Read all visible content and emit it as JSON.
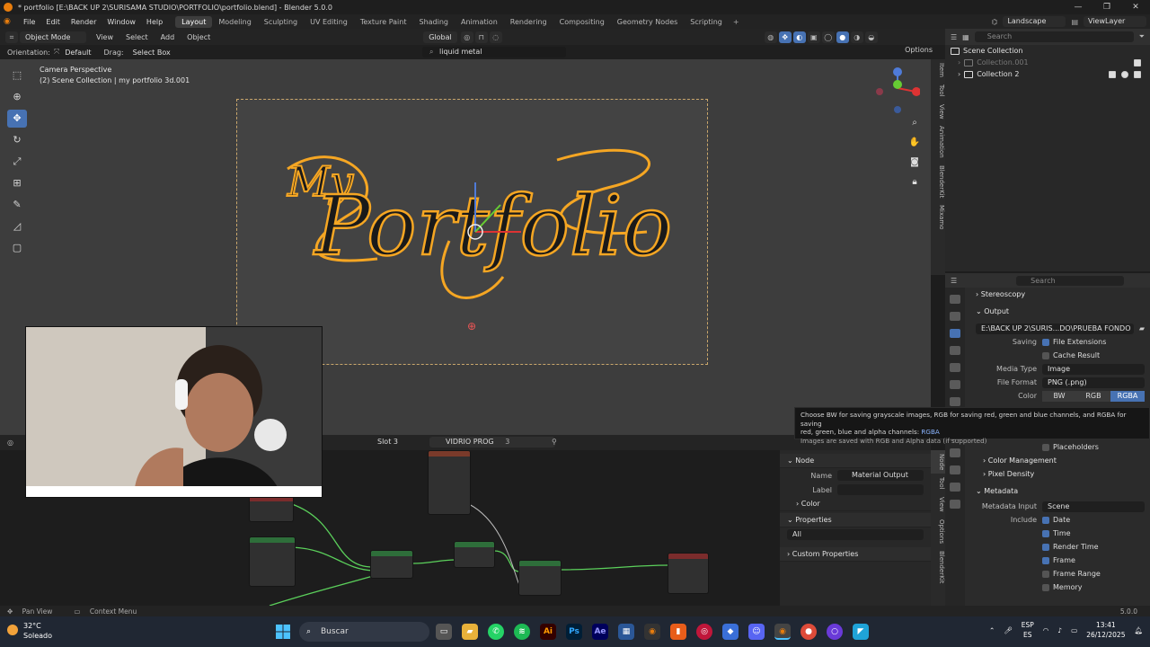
{
  "window": {
    "title": "* portfolio [E:\\BACK UP 2\\SURISAMA STUDIO\\PORTFOLIO\\portfolio.blend] - Blender 5.0.0",
    "controls": [
      "—",
      "❐",
      "✕"
    ]
  },
  "menubar": {
    "menus": [
      "File",
      "Edit",
      "Render",
      "Window",
      "Help"
    ],
    "workspaces": [
      "Layout",
      "Modeling",
      "Sculpting",
      "UV Editing",
      "Texture Paint",
      "Shading",
      "Animation",
      "Rendering",
      "Compositing",
      "Geometry Nodes",
      "Scripting"
    ],
    "active_workspace": "Layout",
    "scene": "Landscape",
    "view_layer": "ViewLayer"
  },
  "viewport_header": {
    "mode": "Object Mode",
    "menus": [
      "View",
      "Select",
      "Add",
      "Object"
    ],
    "transform": "Global"
  },
  "tool_settings": {
    "orientation_label": "Orientation:",
    "orientation_value": "Default",
    "drag_label": "Drag:",
    "drag_value": "Select Box",
    "search_value": "liquid metal",
    "options_label": "Options"
  },
  "viewport": {
    "camera_label": "Camera Perspective",
    "collection_label": "(2) Scene Collection | my portfolio 3d.001",
    "logo_text_1": "My",
    "logo_text_2": "Portfolio"
  },
  "side_tabs": [
    "Item",
    "Tool",
    "View",
    "Animation",
    "BlenderKit",
    "Mixamo"
  ],
  "outliner": {
    "search_placeholder": "Search",
    "root": "Scene Collection",
    "items": [
      {
        "label": "Collection.001",
        "dim": true
      },
      {
        "label": "Collection 2",
        "dim": false
      }
    ]
  },
  "properties": {
    "search_placeholder": "Search",
    "stereoscopy": "Stereoscopy",
    "output_section": "Output",
    "output_path": "E:\\BACK UP 2\\SURIS...DO\\PRUEBA FONDO",
    "saving_label": "Saving",
    "file_extensions": "File Extensions",
    "cache_result": "Cache Result",
    "media_type_label": "Media Type",
    "media_type_value": "Image",
    "file_format_label": "File Format",
    "file_format_value": "PNG (.png)",
    "color_label": "Color",
    "color_options": [
      "BW",
      "RGB",
      "RGBA"
    ],
    "color_active": "RGBA",
    "placeholders": "Placeholders",
    "color_management": "Color Management",
    "pixel_density": "Pixel Density",
    "metadata_section": "Metadata",
    "metadata_input_label": "Metadata Input",
    "metadata_input_value": "Scene",
    "include_label": "Include",
    "include_items": [
      {
        "label": "Date",
        "checked": true
      },
      {
        "label": "Time",
        "checked": true
      },
      {
        "label": "Render Time",
        "checked": true
      },
      {
        "label": "Frame",
        "checked": true
      },
      {
        "label": "Frame Range",
        "checked": false
      },
      {
        "label": "Memory",
        "checked": false
      }
    ]
  },
  "tooltip": {
    "line1": "Choose BW for saving grayscale images, RGB for saving red, green and blue channels, and RGBA for saving",
    "line2": "red, green, blue and alpha channels: ",
    "line2_value": "RGBA",
    "line3": "Images are saved with RGB and Alpha data (if supported)"
  },
  "node_editor": {
    "slot": "Slot 3",
    "material": "VIDRIO PROG",
    "users": "3"
  },
  "node_sidebar": {
    "node_section": "Node",
    "name_label": "Name",
    "name_value": "Material Output",
    "label_label": "Label",
    "label_value": "",
    "color_section": "Color",
    "properties_section": "Properties",
    "properties_value": "All",
    "custom_properties": "Custom Properties",
    "tabs": [
      "Node",
      "Tool",
      "View",
      "Options",
      "BlenderKit"
    ]
  },
  "statusbar": {
    "pan_view": "Pan View",
    "context_menu": "Context Menu",
    "version": "5.0.0"
  },
  "taskbar": {
    "temperature": "32°C",
    "weather": "Soleado",
    "search": "Buscar",
    "lang_1": "ESP",
    "lang_2": "ES",
    "time": "13:41",
    "date": "26/12/2025"
  },
  "colors": {
    "accent": "#4772b3",
    "blender_orange": "#e87d0d",
    "viewport_bg": "#3d3d3d",
    "selection_outline": "#f5a623"
  }
}
